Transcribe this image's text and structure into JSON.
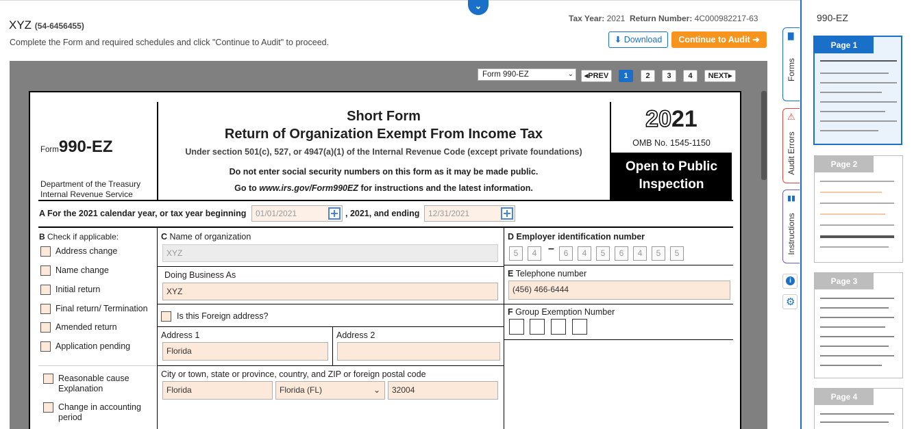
{
  "header": {
    "org_name": "XYZ",
    "org_ein": "(54-6456455)",
    "instructions": "Complete the Form and required schedules and click \"Continue to Audit\" to proceed.",
    "tax_year_label": "Tax Year:",
    "tax_year": "2021",
    "return_number_label": "Return Number:",
    "return_number": "4C000982217-63",
    "download_label": "Download",
    "audit_label": "Continue to Audit"
  },
  "viewer": {
    "form_select_value": "Form 990-EZ",
    "prev_label": "PREV",
    "next_label": "NEXT",
    "pages": [
      "1",
      "2",
      "3",
      "4"
    ],
    "active_page": "1"
  },
  "form": {
    "form_prefix": "Form",
    "form_number": "990-EZ",
    "dept_line1": "Department of the Treasury",
    "dept_line2": "Internal Revenue Service",
    "title1": "Short Form",
    "title2": "Return of Organization Exempt From Income Tax",
    "subtitle": "Under section 501(c), 527, or 4947(a)(1) of the Internal Revenue Code (except private foundations)",
    "notice": "Do not enter social security numbers on this form as it may be made public.",
    "goto_prefix": "Go to",
    "goto_url": "www.irs.gov/Form990EZ",
    "goto_suffix": "for instructions and the latest information.",
    "year_light": "20",
    "year_bold": "21",
    "omb": "OMB No. 1545-1150",
    "open_public": "Open to Public",
    "inspection": "Inspection",
    "line_a_prefix": "A For the 2021 calendar year, or tax year beginning",
    "begin_date": "01/01/2021",
    "line_a_mid": ", 2021, and ending",
    "end_date": "12/31/2021",
    "section_b_label": "B",
    "section_b_title": "Check if applicable:",
    "checks": [
      "Address change",
      "Name change",
      "Initial return",
      "Final return/ Termination",
      "Amended return",
      "Application pending"
    ],
    "reasonable_cause": "Reasonable cause Explanation",
    "change_accounting": "Change in accounting period",
    "section_c_label": "C",
    "section_c_title": "Name of organization",
    "org_name_value": "XYZ",
    "dba_label": "Doing Business As",
    "dba_value": "XYZ",
    "foreign_label": "Is this Foreign address?",
    "address1_label": "Address 1",
    "address1_value": "Florida",
    "address2_label": "Address 2",
    "address2_value": "",
    "city_label": "City or town, state or province, country, and ZIP or foreign postal code",
    "city_value": "Florida",
    "state_value": "Florida (FL)",
    "zip_value": "32004",
    "section_d_label": "D",
    "section_d_title": "Employer identification number",
    "ein_digits_a": [
      "5",
      "4"
    ],
    "ein_digits_b": [
      "6",
      "4",
      "5",
      "6",
      "4",
      "5",
      "5"
    ],
    "section_e_label": "E",
    "section_e_title": "Telephone number",
    "phone_value": "(456) 466-6444",
    "section_f_label": "F",
    "section_f_title": "Group Exemption Number"
  },
  "sidebar_tabs": [
    "Forms",
    "Audit Errors",
    "Instructions"
  ],
  "thumbnails": {
    "title": "990-EZ",
    "pages": [
      "Page 1",
      "Page 2",
      "Page 3",
      "Page 4"
    ]
  },
  "colors": {
    "accent": "#1a6fc9",
    "audit_button": "#f7941d",
    "input_fill": "#fde9d9",
    "error": "#e0453b"
  }
}
